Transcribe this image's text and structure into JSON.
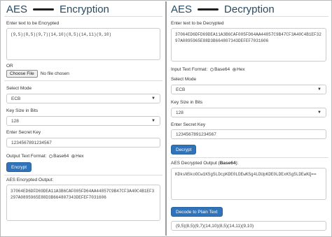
{
  "encryption": {
    "title_prefix": "AES",
    "title_word": "Encryption",
    "input_label": "Enter text to be Encrypted",
    "input_value": "(9,5)(8,5)(9,7)(14,10)(8,5)(14,11)(9,10)",
    "or_label": "OR",
    "choose_file_label": "Choose File",
    "no_file_label": "No file chosen",
    "mode_label": "Select Mode",
    "mode_value": "ECB",
    "keysize_label": "Key Size in Bits",
    "keysize_value": "128",
    "secret_label": "Enter Secret Key",
    "secret_value": "1234567891234567",
    "format_label": "Output Text Format:",
    "format_opt1": "Base64",
    "format_opt2": "Hex",
    "format_selected": "Hex",
    "encrypt_button": "Encrypt",
    "output_label": "AES Encrypted Output:",
    "output_value": "37064ED6DFD69DEA11A3B6CAF005FD64AA44857C9B47CF3A40C4B1EF3297A0895965E88D3B664807343DEFEF7031606"
  },
  "decryption": {
    "title_prefix": "AES",
    "title_word": "Decryption",
    "input_label": "Enter text to be Decrypted",
    "input_value": "37064ED6DFD69DEA11A3B6CAF005FD64AA44857C9B47CF3A40C4B1EF3297A0895965E88D3B664807343DEFEF7031606",
    "format_label": "Input Text Format:",
    "format_opt1": "Base64",
    "format_opt2": "Hex",
    "format_selected": "Hex",
    "mode_label": "Select Mode",
    "mode_value": "ECB",
    "keysize_label": "Key Size in Bits",
    "keysize_value": "128",
    "secret_label": "Enter Secret Key",
    "secret_value": "1234567891234567",
    "decrypt_button": "Decrypt",
    "output_label_prefix": "AES Decrypted Output (",
    "output_label_bold": "Base64",
    "output_label_suffix": "):",
    "output_value": "KDksNSkoOCw1KSg5LDcpKDE0LDEwKSg4LDUpKDE0LDExKSg5LDEwKQ==",
    "plain_button": "Decode to Plain Text",
    "plain_value": "(9,5)(8,5)(9,7)(14,10)(8,5)(14,11)(9,10)"
  },
  "icons": {
    "dropdown": "chevron-down-icon",
    "radio": "radio-icon"
  }
}
